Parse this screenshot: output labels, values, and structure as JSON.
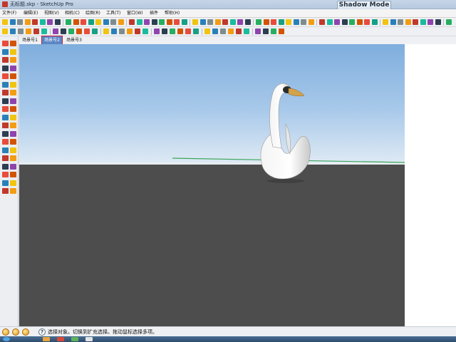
{
  "window": {
    "title": "无标题.skp - SketchUp Pro",
    "overlay_button": "Shadow Mode"
  },
  "menu": {
    "items": [
      {
        "label": "文件(F)"
      },
      {
        "label": "编辑(E)"
      },
      {
        "label": "视图(V)"
      },
      {
        "label": "相机(C)"
      },
      {
        "label": "绘图(R)"
      },
      {
        "label": "工具(T)"
      },
      {
        "label": "窗口(W)"
      },
      {
        "label": "插件"
      },
      {
        "label": "帮助(H)"
      }
    ]
  },
  "scenes": {
    "tabs": [
      {
        "label": "场景号1"
      },
      {
        "label": "场景号2",
        "active": true
      },
      {
        "label": "场景号3"
      }
    ]
  },
  "viewport": {
    "model": "swan",
    "colors": {
      "sky_top": "#7faedd",
      "sky_bottom": "#dfeaf4",
      "ground": "#4d4d4d",
      "green_axis": "#3aa65a"
    }
  },
  "status": {
    "help_glyph": "?",
    "text": "选择对象。切换到扩充选择。拖动鼠标选择多项。"
  },
  "colors": {
    "active_tab": "#5a86c5",
    "tab_highlight": "#d0183a",
    "titlebar": "#c7d6e8"
  }
}
